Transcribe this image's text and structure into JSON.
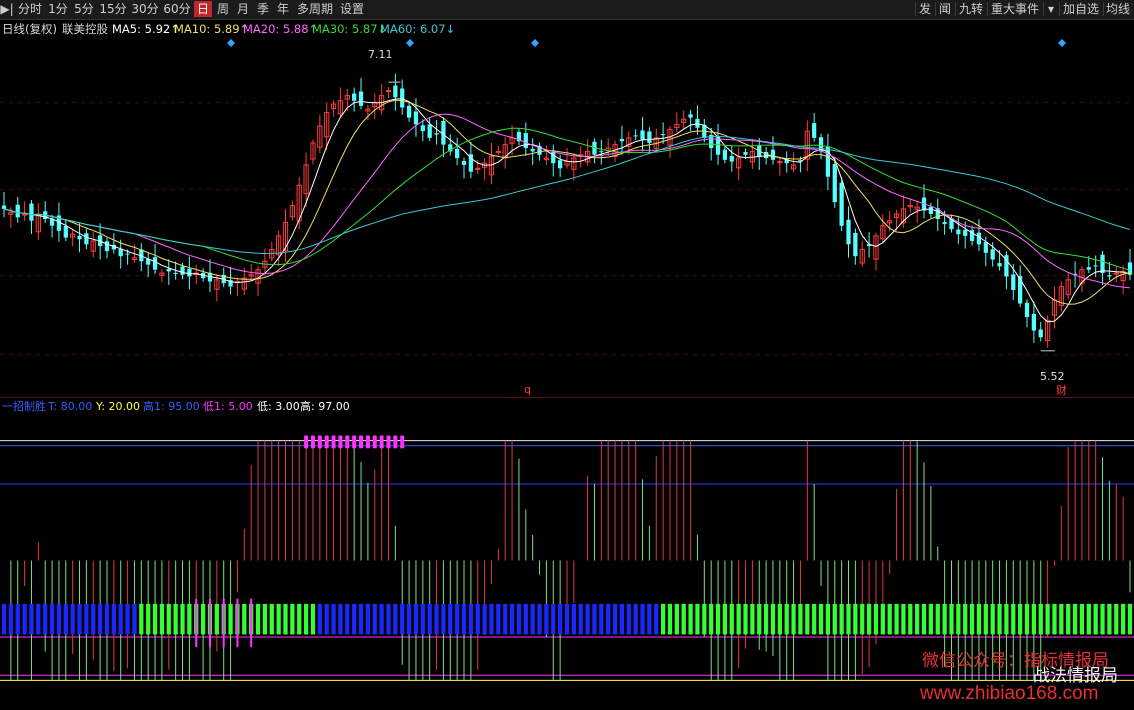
{
  "toolbar": {
    "left": [
      {
        "key": "play",
        "label": "▶|",
        "w": 14
      },
      {
        "key": "fenshi",
        "label": "分时",
        "w": 28
      },
      {
        "key": "1m",
        "label": "1分",
        "w": 24
      },
      {
        "key": "5m",
        "label": "5分",
        "w": 24
      },
      {
        "key": "15m",
        "label": "15分",
        "w": 30
      },
      {
        "key": "30m",
        "label": "30分",
        "w": 30
      },
      {
        "key": "60m",
        "label": "60分",
        "w": 30
      },
      {
        "key": "day",
        "label": "日",
        "w": 18,
        "active": true
      },
      {
        "key": "week",
        "label": "周",
        "w": 18
      },
      {
        "key": "month",
        "label": "月",
        "w": 18
      },
      {
        "key": "season",
        "label": "季",
        "w": 18
      },
      {
        "key": "year",
        "label": "年",
        "w": 18
      },
      {
        "key": "multi",
        "label": "多周期",
        "w": 42
      },
      {
        "key": "settings",
        "label": "设置",
        "w": 28
      }
    ],
    "right": [
      {
        "key": "fa",
        "label": "发",
        "w": 18
      },
      {
        "key": "wen",
        "label": "闻",
        "w": 18
      },
      {
        "key": "jiuzhuan",
        "label": "九转",
        "w": 30
      },
      {
        "key": "events",
        "label": "重大事件",
        "w": 54
      },
      {
        "key": "dropdown",
        "label": "▾",
        "w": 14
      },
      {
        "key": "addfav",
        "label": "加自选",
        "w": 42
      },
      {
        "key": "jx",
        "label": "均线",
        "w": 28
      }
    ]
  },
  "info_bar": {
    "period": "日线(复权)",
    "stock": "联美控股",
    "ma5": "MA5: 5.92↑",
    "ma10": "MA10: 5.89↑",
    "ma20": "MA20: 5.88↑",
    "ma30": "MA30: 5.87↓",
    "ma60": "MA60: 6.07↓"
  },
  "annotations": {
    "high": "7.11",
    "low": "5.52",
    "q_marker": "q",
    "cai_marker": "财"
  },
  "indicator_bar": {
    "name": "一招制胜",
    "t": "T: 80.00",
    "y": "Y: 20.00",
    "gao1": "高1: 95.00",
    "di1": "低1: 5.00",
    "di": "低: 3.00",
    "gao": "高: 97.00"
  },
  "watermark": {
    "line1": "微信公众号：指标情报局",
    "line2": "战法情报局",
    "url": "www.zhibiao168.com"
  },
  "colors": {
    "up": "#ff3b3b",
    "down": "#54ffff",
    "ma5": "#ffffff",
    "ma10": "#f0e060",
    "ma20": "#ff66ff",
    "ma30": "#33dd33",
    "ma60": "#3ec8d8",
    "blue_bar": "#1a28ff",
    "green_bar": "#33ff33",
    "magenta": "#ff33ff",
    "yellow": "#ffff33"
  },
  "chart_data": {
    "type": "candlestick",
    "ylim": [
      5.3,
      7.3
    ],
    "high_value": 7.11,
    "low_value": 5.52,
    "closes": [
      6.36,
      6.34,
      6.31,
      6.33,
      6.29,
      6.33,
      6.3,
      6.26,
      6.23,
      6.19,
      6.21,
      6.18,
      6.15,
      6.17,
      6.14,
      6.11,
      6.12,
      6.08,
      6.09,
      6.07,
      6.05,
      6.03,
      6.0,
      5.98,
      5.99,
      5.98,
      5.97,
      5.96,
      5.98,
      5.95,
      5.93,
      5.94,
      5.92,
      5.9,
      5.93,
      5.95,
      5.97,
      6.0,
      6.05,
      6.12,
      6.2,
      6.28,
      6.38,
      6.5,
      6.62,
      6.75,
      6.85,
      6.93,
      6.98,
      7.0,
      7.03,
      7.0,
      6.97,
      6.95,
      6.99,
      7.03,
      7.06,
      7.02,
      6.96,
      6.9,
      6.86,
      6.82,
      6.78,
      6.8,
      6.74,
      6.7,
      6.66,
      6.62,
      6.58,
      6.6,
      6.63,
      6.67,
      6.7,
      6.74,
      6.78,
      6.76,
      6.72,
      6.7,
      6.68,
      6.66,
      6.63,
      6.6,
      6.64,
      6.66,
      6.68,
      6.7,
      6.68,
      6.7,
      6.72,
      6.74,
      6.76,
      6.78,
      6.79,
      6.77,
      6.75,
      6.78,
      6.8,
      6.83,
      6.86,
      6.89,
      6.9,
      6.84,
      6.78,
      6.72,
      6.68,
      6.65,
      6.64,
      6.66,
      6.68,
      6.7,
      6.67,
      6.66,
      6.65,
      6.64,
      6.63,
      6.62,
      6.64,
      6.82,
      6.78,
      6.7,
      6.55,
      6.4,
      6.26,
      6.15,
      6.08,
      6.12,
      6.14,
      6.2,
      6.26,
      6.29,
      6.33,
      6.36,
      6.38,
      6.37,
      6.35,
      6.33,
      6.3,
      6.27,
      6.24,
      6.21,
      6.2,
      6.17,
      6.15,
      6.1,
      6.06,
      6.02,
      5.96,
      5.88,
      5.8,
      5.72,
      5.64,
      5.6,
      5.7,
      5.82,
      5.9,
      5.94,
      5.97,
      6.0,
      6.0,
      6.02,
      5.98,
      5.96,
      5.98,
      5.99,
      5.97
    ]
  }
}
